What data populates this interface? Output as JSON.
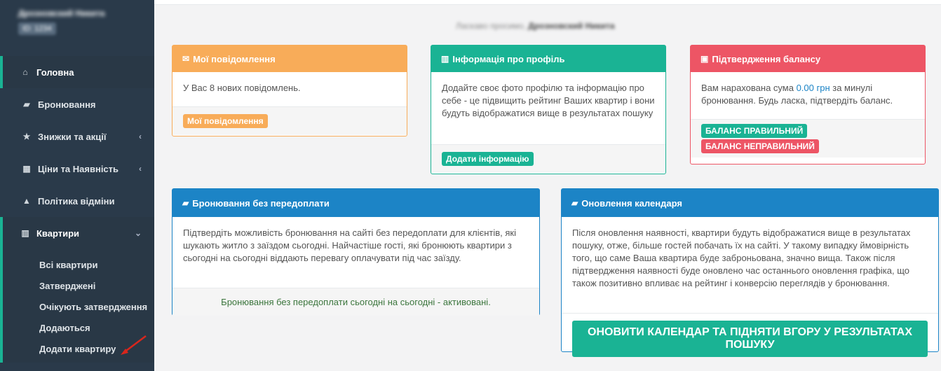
{
  "profile": {
    "name": "Дрозновский Никита",
    "id": "ID: 1234"
  },
  "greeting": {
    "prefix": "Ласкаво просимо,",
    "name": "Дрозновский Никита"
  },
  "nav": {
    "home": "Головна",
    "bookings": "Бронювання",
    "discounts": "Знижки та акції",
    "prices": "Ціни та Наявність",
    "cancel_policy": "Політика відміни",
    "apartments": "Квартири",
    "sub": [
      "Всі квартири",
      "Затверджені",
      "Очікують затвердження",
      "Додаються",
      "Додати квартиру"
    ]
  },
  "cards": {
    "messages": {
      "title": "Мої повідомлення",
      "text": "У Вас 8 нових повідомлень.",
      "button": "Мої повідомлення"
    },
    "profile_info": {
      "title": "Інформація про профіль",
      "text": "Додайте своє фото профілю та інформацію про себе - це підвищить рейтинг Ваших квартир і вони будуть відображатися вище в результатах пошуку",
      "button": "Додати інформацію"
    },
    "balance": {
      "title": "Підтвердження балансу",
      "text_before": "Вам нарахована сума ",
      "amount": "0.00 грн",
      "text_after": " за минулі бронювання. Будь ласка, підтвердіть баланс.",
      "btn_ok": "БАЛАНС ПРАВИЛЬНИЙ",
      "btn_bad": "БАЛАНС НЕПРАВИЛЬНИЙ"
    },
    "no_prepay": {
      "title": "Бронювання без передоплати",
      "text": "Підтвердіть можливість бронювання на сайті без передоплати для клієнтів, які шукають житло з заїздом сьогодні. Найчастіше гості, які бронюють квартири з сьогодні на сьогодні віддають перевагу оплачувати під час заїзду.",
      "status": "Бронювання без передоплати сьогодні на сьогодні - активовані."
    },
    "calendar": {
      "title": "Оновлення календаря",
      "text": "Після оновлення наявності, квартири будуть відображатися вище в результатах пошуку, отже, більше гостей побачать їх на сайті. У такому випадку ймовірність того, що саме Ваша квартира буде заброньована, значно вища. Також після підтвердження наявності буде оновлено час останнього оновлення графіка, що також позитивно впливає на рейтинг і конверсію переглядів у бронювання.",
      "button": "ОНОВИТИ КАЛЕНДАР ТА ПІДНЯТИ ВГОРУ У РЕЗУЛЬТАТАХ ПОШУКУ"
    }
  }
}
